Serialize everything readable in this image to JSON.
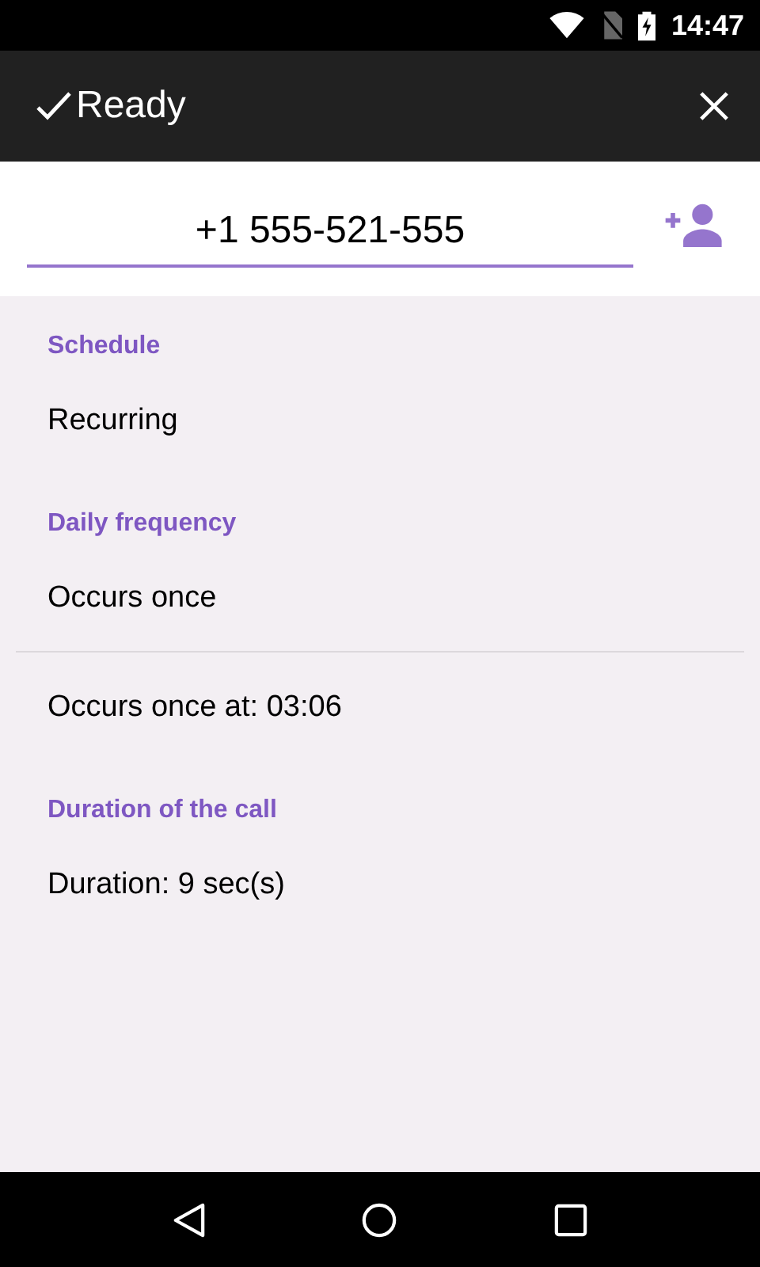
{
  "status_bar": {
    "time": "14:47"
  },
  "toolbar": {
    "title": "Ready"
  },
  "phone": {
    "value": "+1 555-521-555"
  },
  "items": [
    {
      "kind": "header",
      "text": "Schedule"
    },
    {
      "kind": "value",
      "text": "Recurring"
    },
    {
      "kind": "header",
      "text": "Daily frequency"
    },
    {
      "kind": "value",
      "text": "Occurs once"
    },
    {
      "kind": "divider"
    },
    {
      "kind": "value",
      "text": "Occurs once at: 03:06"
    },
    {
      "kind": "header",
      "text": "Duration of the call"
    },
    {
      "kind": "value",
      "text": "Duration: 9 sec(s)"
    }
  ]
}
